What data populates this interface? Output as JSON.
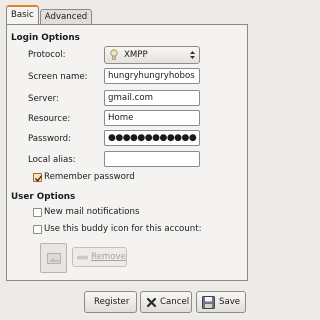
{
  "tabs": [
    {
      "label": "Basic",
      "active": true
    },
    {
      "label": "Advanced",
      "active": false
    }
  ],
  "login_options": {
    "title": "Login Options",
    "protocol": {
      "label": "Protocol:",
      "value": "XMPP"
    },
    "screen_name": {
      "label": "Screen name:",
      "value": "hungryhungryhobos"
    },
    "server": {
      "label": "Server:",
      "value": "gmail.com"
    },
    "resource": {
      "label": "Resource:",
      "value": "Home"
    },
    "password": {
      "label": "Password:",
      "value": "●●●●●●●●●●●●"
    },
    "local_alias": {
      "label": "Local alias:",
      "value": ""
    },
    "remember_password": {
      "label": "Remember password",
      "checked": true
    }
  },
  "user_options": {
    "title": "User Options",
    "new_mail": {
      "label": "New mail notifications",
      "checked": false
    },
    "buddy_icon": {
      "label": "Use this buddy icon for this account:",
      "checked": false
    },
    "remove_label": "Remove"
  },
  "buttons": {
    "register": "Register",
    "cancel": "Cancel",
    "save": "Save"
  },
  "colors": {
    "accent": "#e77f22",
    "window_bg": "#edebe7"
  }
}
